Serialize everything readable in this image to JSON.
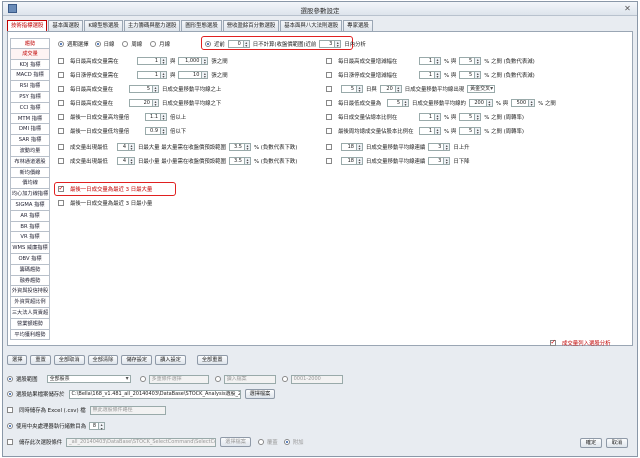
{
  "window": {
    "title": "選股參數設定",
    "close_glyph": "✕"
  },
  "tabs": [
    "技術指標選股",
    "基本面選股",
    "K線型態選股",
    "主力籌碼與壓力選股",
    "圖形型態選股",
    "營收盈餘百分數選股",
    "基本面與八大法則選股",
    "專家選股"
  ],
  "leftnav": [
    "趨勢",
    "成交量",
    "KDJ 指標",
    "MACD 指標",
    "RSI 指標",
    "PSY 指標",
    "CCI 指標",
    "MTM 指標",
    "DMI 指標",
    "SAR 指標",
    "波動均量",
    "布林通道選股",
    "新均價線",
    "價均線",
    "均心加力線指標",
    "SIGMA 指標",
    "AR 指標",
    "BR 指標",
    "VR 指標",
    "WMS 威廉指標",
    "OBV 指標",
    "籌碼趨勢",
    "融券趨勢",
    "外資與投信持股",
    "外資買超比例",
    "三大法人買賣超",
    "營業額趨勢",
    "平均獲利趨勢"
  ],
  "period": {
    "label": "週期選擇",
    "options": [
      "日線",
      "周線",
      "月線"
    ],
    "recent_label": "近前",
    "recent_value": "0",
    "no_count_label": "日不計算(收盤價範圍)近前",
    "days_value": "3",
    "days_unit": "日內分析"
  },
  "left_rows": [
    {
      "a": "每日最高成交量需在",
      "v1": "1",
      "mid": "與",
      "v2": "1,000",
      "b": "張之間"
    },
    {
      "a": "每日漲停成交量需在",
      "v1": "1",
      "mid": "與",
      "v2": "10",
      "b": "張之間"
    },
    {
      "a": "每日最高成交量在",
      "v1": "5",
      "b": "日成交量移動平均線之上"
    },
    {
      "a": "每日最高成交量在",
      "v1": "20",
      "b": "日成交量移動平均線之下"
    },
    {
      "a": "最後一日成交量高均量倍",
      "v1": "1.1",
      "b": "倍以上"
    },
    {
      "a": "最後一日成交量低均量倍",
      "v1": "0.9",
      "b": "倍以下"
    },
    {
      "a": "成交量出現最低",
      "v1": "4",
      "b": "日最大量 最大量需在收盤價預設範圍",
      "v2": "3.5",
      "c": "% (負數代表下跌)"
    },
    {
      "a": "成交量出現最低",
      "v1": "4",
      "b": "日最小量 最小量需在收盤價預設範圍",
      "v2": "3.5",
      "c": "% (負數代表下跌)"
    },
    {
      "a": "最後一日成交量為最近 3 日最大量"
    },
    {
      "a": "最後一日成交量為最近 3 日最小量"
    }
  ],
  "right_rows": [
    {
      "a": "每日最高成交量增減幅在",
      "v1": "1",
      "mid": "% 與",
      "v2": "5",
      "b": "% 之間 (負數代表減)"
    },
    {
      "a": "每日漲停成交量增減幅在",
      "v1": "1",
      "mid": "% 與",
      "v2": "5",
      "b": "% 之間 (負數代表減)"
    },
    {
      "v1": "5",
      "mid": "日與",
      "v2": "20",
      "b": "日成交量移動平均線出現",
      "combo": "黃金交叉"
    },
    {
      "a": "每日最低成交量為",
      "v1": "5",
      "mid": "日成交量移動平均線的",
      "v2": "200",
      "b": "% 與",
      "v3": "500",
      "c": "% 之間"
    },
    {
      "a": "每日成交量佔總本比例在",
      "v1": "1",
      "mid": "% 與",
      "v2": "5",
      "b": "% 之間 (周轉率)"
    },
    {
      "a": "最後周均總成交量佔股本比例在",
      "v1": "1",
      "mid": "% 與",
      "v2": "5",
      "b": "% 之間 (周轉率)"
    },
    {
      "v1": "18",
      "mid": "日成交量移動平均線連續",
      "v2": "3",
      "b": "日上升"
    },
    {
      "v1": "18",
      "mid": "日成交量移動平均線連續",
      "v2": "3",
      "b": "日下降"
    }
  ],
  "include_volume": "成交量列入選股分析",
  "buttons": [
    "選擇",
    "重置",
    "全部取消",
    "全部清除",
    "儲存設定",
    "讀入設定",
    "全部重置"
  ],
  "scope": {
    "label": "選股範圍",
    "market": "全部股票",
    "multi_label": "多重條件選擇",
    "input_label": "讀入檔案",
    "range_label": "0001-2000"
  },
  "result_file": {
    "label": "選股結果檔案儲存於",
    "path": "C:\\Bella\\168_v1.481_all_20140403\\DataBase\\STOCK_Analysis選股_2.sel",
    "button": "選擇檔案"
  },
  "excel": {
    "label": "同時儲存為 Excel (.csv) 檔",
    "placeholder": "無此選股條件路徑"
  },
  "threads": {
    "label": "使用中央處理器執行緒數目為",
    "value": "8"
  },
  "save_cond": {
    "label": "儲存此次選股條件",
    "path": "_all_20140403\\DataBase\\STOCK_SelectCommand\\SelectCommand.cot",
    "button": "選擇檔案",
    "overwrite": "覆蓋",
    "append": "附加"
  },
  "footer": {
    "ok": "確定",
    "cancel": "取消"
  }
}
